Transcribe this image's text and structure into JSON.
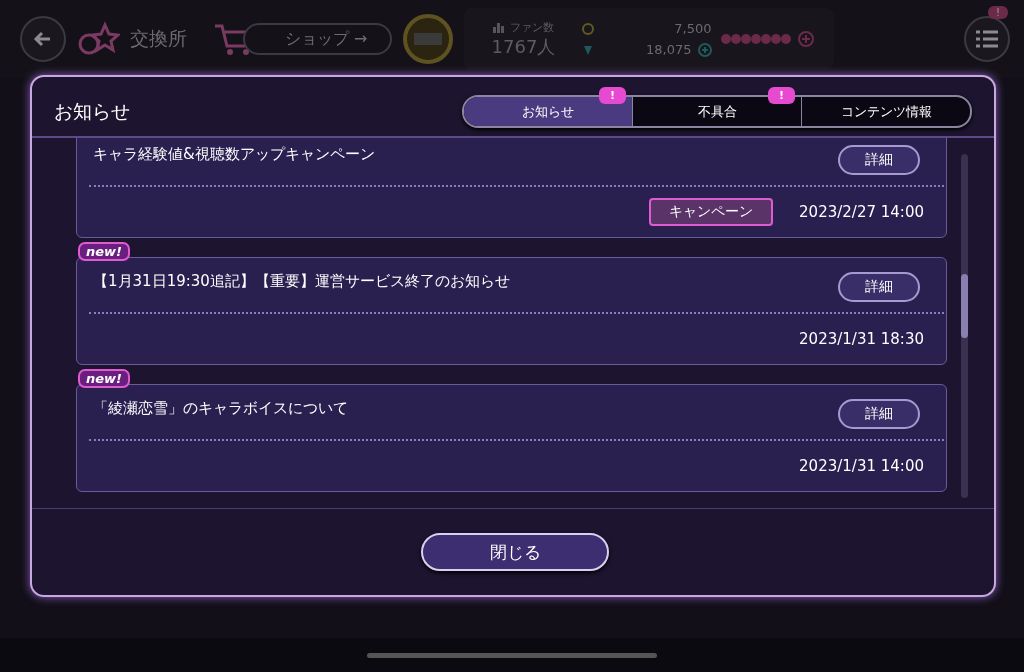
{
  "top_bar": {
    "title": "交換所",
    "shop_button": "ショップ →",
    "fans_label": "ファン数",
    "fans_value": "1767人",
    "coins": "7,500",
    "gems": "18,075",
    "menu_alert": "!"
  },
  "dialog": {
    "title": "お知らせ",
    "tabs": [
      {
        "label": "お知らせ",
        "selected": true,
        "alert": "!"
      },
      {
        "label": "不具合",
        "selected": false,
        "alert": "!"
      },
      {
        "label": "コンテンツ情報",
        "selected": false
      }
    ],
    "items": [
      {
        "title": "キャラ経験値&視聴数アップキャンペーン",
        "button": "詳細",
        "tag": "キャンペーン",
        "date": "2023/2/27 14:00"
      },
      {
        "badge": "new!",
        "title": "【1月31日19:30追記】【重要】運営サービス終了のお知らせ",
        "button": "詳細",
        "date": "2023/1/31 18:30"
      },
      {
        "badge": "new!",
        "title": "「綾瀬恋雪」のキャラボイスについて",
        "button": "詳細",
        "date": "2023/1/31 14:00"
      }
    ],
    "close_button": "閉じる"
  }
}
